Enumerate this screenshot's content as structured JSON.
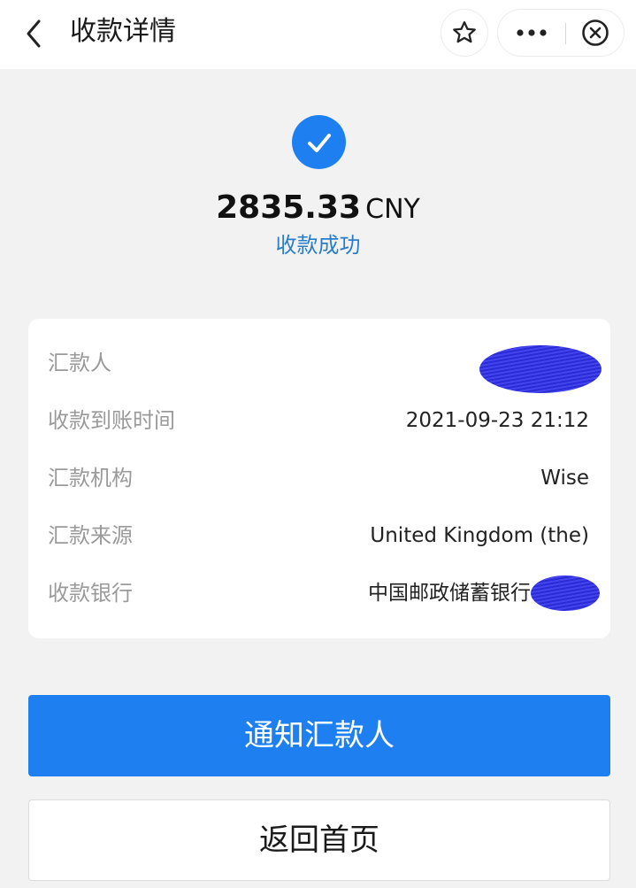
{
  "header": {
    "title": "收款详情",
    "back_icon": "chevron-left-icon",
    "star_icon": "star-outline-icon",
    "more_icon": "more-dots-icon",
    "close_icon": "close-circle-icon"
  },
  "status": {
    "icon": "check-circle-icon",
    "amount": "2835.33",
    "currency": "CNY",
    "text": "收款成功"
  },
  "details": {
    "rows": [
      {
        "label": "汇款人",
        "value": ""
      },
      {
        "label": "收款到账时间",
        "value": "2021-09-23 21:12"
      },
      {
        "label": "汇款机构",
        "value": "Wise"
      },
      {
        "label": "汇款来源",
        "value": "United Kingdom (the)"
      },
      {
        "label": "收款银行",
        "value": "中国邮政储蓄银行"
      }
    ]
  },
  "actions": {
    "notify_label": "通知汇款人",
    "home_label": "返回首页"
  },
  "colors": {
    "accent": "#1e80f0",
    "status_text": "#2a7dc9",
    "background": "#f2f2f2",
    "redaction": "#2b2bd6"
  }
}
